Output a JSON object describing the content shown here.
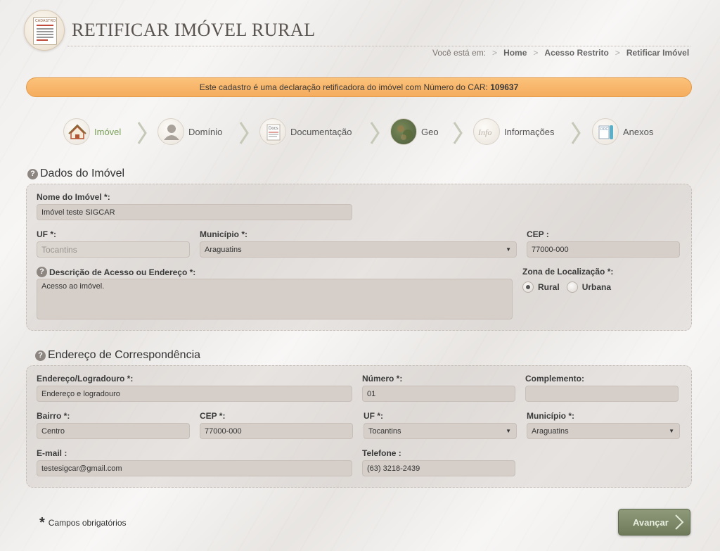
{
  "header": {
    "logo_text": "CADASTRO",
    "title": "RETIFICAR IMÓVEL RURAL"
  },
  "breadcrumb": {
    "prefix": "Você está em:",
    "items": [
      "Home",
      "Acesso Restrito",
      "Retificar Imóvel"
    ]
  },
  "notice": {
    "text": "Este cadastro é uma declaração retificadora do imóvel com Número do CAR:",
    "car_number": "109637"
  },
  "steps": [
    {
      "label": "Imóvel",
      "icon": "house-icon",
      "active": true
    },
    {
      "label": "Domínio",
      "icon": "person-icon",
      "active": false
    },
    {
      "label": "Documentação",
      "icon": "docs-icon",
      "active": false
    },
    {
      "label": "Geo",
      "icon": "map-icon",
      "active": false
    },
    {
      "label": "Informações",
      "icon": "info-icon",
      "active": false
    },
    {
      "label": "Anexos",
      "icon": "attachment-icon",
      "active": false
    }
  ],
  "steps_icon_text": {
    "docs": "Docs",
    "info": "Info",
    "doc": "DOC"
  },
  "dados_imovel": {
    "title": "Dados do Imóvel",
    "nome_label": "Nome do Imóvel *:",
    "nome_value": "Imóvel teste SIGCAR",
    "uf_label": "UF *:",
    "uf_value": "Tocantins",
    "municipio_label": "Município *:",
    "municipio_value": "Araguatins",
    "cep_label": "CEP :",
    "cep_value": "77000-000",
    "descricao_label": "Descrição de Acesso ou Endereço *:",
    "descricao_value": "Acesso ao imóvel.",
    "zona_label": "Zona de Localização *:",
    "zona_options": [
      "Rural",
      "Urbana"
    ],
    "zona_selected": "Rural"
  },
  "endereco": {
    "title": "Endereço de Correspondência",
    "logradouro_label": "Endereço/Logradouro *:",
    "logradouro_value": "Endereço e logradouro",
    "numero_label": "Número *:",
    "numero_value": "01",
    "complemento_label": "Complemento:",
    "complemento_value": "",
    "bairro_label": "Bairro *:",
    "bairro_value": "Centro",
    "cep_label": "CEP *:",
    "cep_value": "77000-000",
    "uf_label": "UF *:",
    "uf_value": "Tocantins",
    "municipio_label": "Município *:",
    "municipio_value": "Araguatins",
    "email_label": "E-mail :",
    "email_value": "testesigcar@gmail.com",
    "telefone_label": "Telefone :",
    "telefone_value": "(63) 3218-2439"
  },
  "footer": {
    "required_note": "Campos obrigatórios",
    "next_button": "Avançar"
  },
  "colors": {
    "notice_bg": "#f5ac5e",
    "active_step": "#7aa05a",
    "button": "#7a8666"
  }
}
